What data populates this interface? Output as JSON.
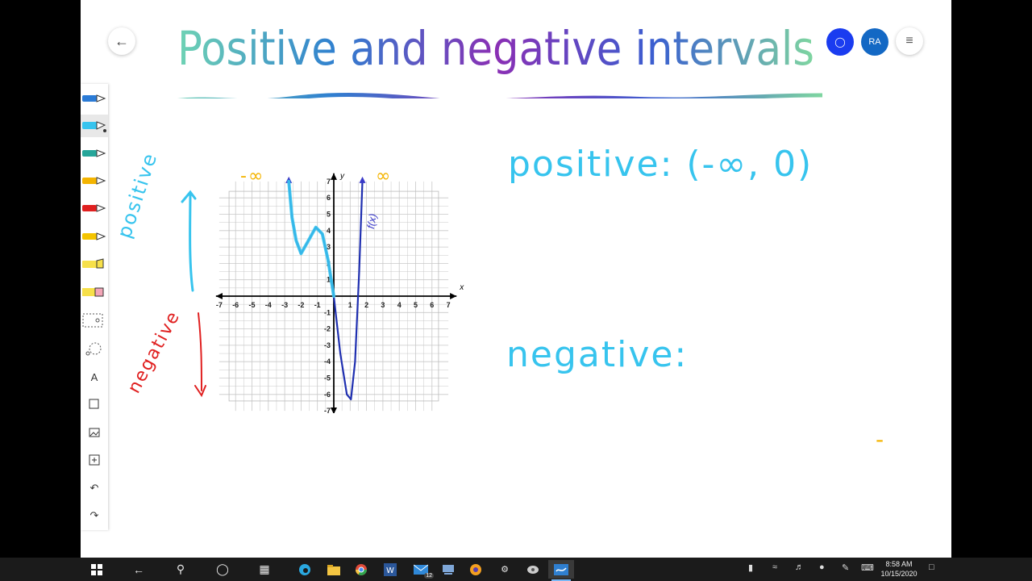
{
  "header": {
    "title": "Positive and negative intervals",
    "avatar_initials": "RA",
    "back_icon": "arrow-left-icon",
    "share_icon": "person-icon",
    "menu_icon": "hamburger-menu-icon"
  },
  "toolbar": {
    "tools": [
      {
        "name": "pen-blue",
        "color": "#2b7bd6"
      },
      {
        "name": "pen-lightblue-selected",
        "color": "#37c4ee"
      },
      {
        "name": "pen-teal",
        "color": "#26a69a"
      },
      {
        "name": "pen-yellow",
        "color": "#f4b400"
      },
      {
        "name": "pen-red",
        "color": "#e02020"
      },
      {
        "name": "pen-yellow-2",
        "color": "#f4c400"
      },
      {
        "name": "highlighter-yellow",
        "color": "#f7e04a"
      },
      {
        "name": "eraser",
        "color": "#f3a6b8"
      },
      {
        "name": "ruler",
        "color": "#555555"
      },
      {
        "name": "lasso",
        "color": "#555555"
      },
      {
        "name": "text",
        "color": "#333333",
        "glyph": "A"
      },
      {
        "name": "note",
        "color": "#333333"
      },
      {
        "name": "image",
        "color": "#333333"
      },
      {
        "name": "add",
        "color": "#333333"
      },
      {
        "name": "undo",
        "color": "#333333"
      },
      {
        "name": "redo",
        "color": "#333333"
      }
    ]
  },
  "canvas": {
    "positive_label": "positive: (-∞, 0)",
    "negative_label": "negative:",
    "side_positive": "positive",
    "side_negative": "negative",
    "neg_inf_mark": "-∞",
    "pos_inf_mark": "∞",
    "dash_mark": "-",
    "function_label": "f(x)"
  },
  "chart_data": {
    "type": "line",
    "title": "",
    "xlabel": "x",
    "ylabel": "y",
    "xlim": [
      -7,
      7
    ],
    "ylim": [
      -7,
      7
    ],
    "grid": true,
    "xticks": [
      -7,
      -6,
      -5,
      -4,
      -3,
      -2,
      -1,
      1,
      2,
      3,
      4,
      5,
      6,
      7
    ],
    "yticks": [
      -7,
      -6,
      -5,
      -4,
      -3,
      -2,
      -1,
      1,
      2,
      3,
      4,
      5,
      6,
      7
    ],
    "series": [
      {
        "name": "f(x)",
        "color": "#1f2fb0",
        "x": [
          -2.75,
          -2.55,
          -2.3,
          -2.0,
          -1.6,
          -1.1,
          -0.7,
          -0.35,
          0.0,
          0.4,
          0.8,
          1.05,
          1.3,
          1.55,
          1.75
        ],
        "y": [
          7.0,
          4.8,
          3.4,
          2.6,
          3.3,
          4.2,
          3.8,
          2.2,
          0.0,
          -3.5,
          -6.0,
          -6.3,
          -4.0,
          1.5,
          7.0
        ]
      }
    ],
    "ink_series": [
      {
        "name": "",
        "color": "#37c4ee",
        "x": [
          -2.75,
          -2.55,
          -2.3,
          -2.0,
          -1.6,
          -1.1,
          -0.7,
          -0.35,
          0.0
        ],
        "y": [
          7.0,
          4.8,
          3.4,
          2.6,
          3.3,
          4.2,
          3.8,
          2.2,
          0.0
        ]
      }
    ]
  },
  "taskbar": {
    "time": "8:58 AM",
    "date": "10/15/2020",
    "mail_badge": "12",
    "apps": [
      "start-icon",
      "back-arrow-icon",
      "search-icon",
      "cortana-icon",
      "task-view-icon",
      "edge-icon",
      "file-explorer-icon",
      "chrome-icon",
      "word-icon",
      "mail-icon",
      "app-icon",
      "app-icon-2",
      "settings-icon",
      "app-icon-3",
      "whiteboard-icon"
    ]
  }
}
